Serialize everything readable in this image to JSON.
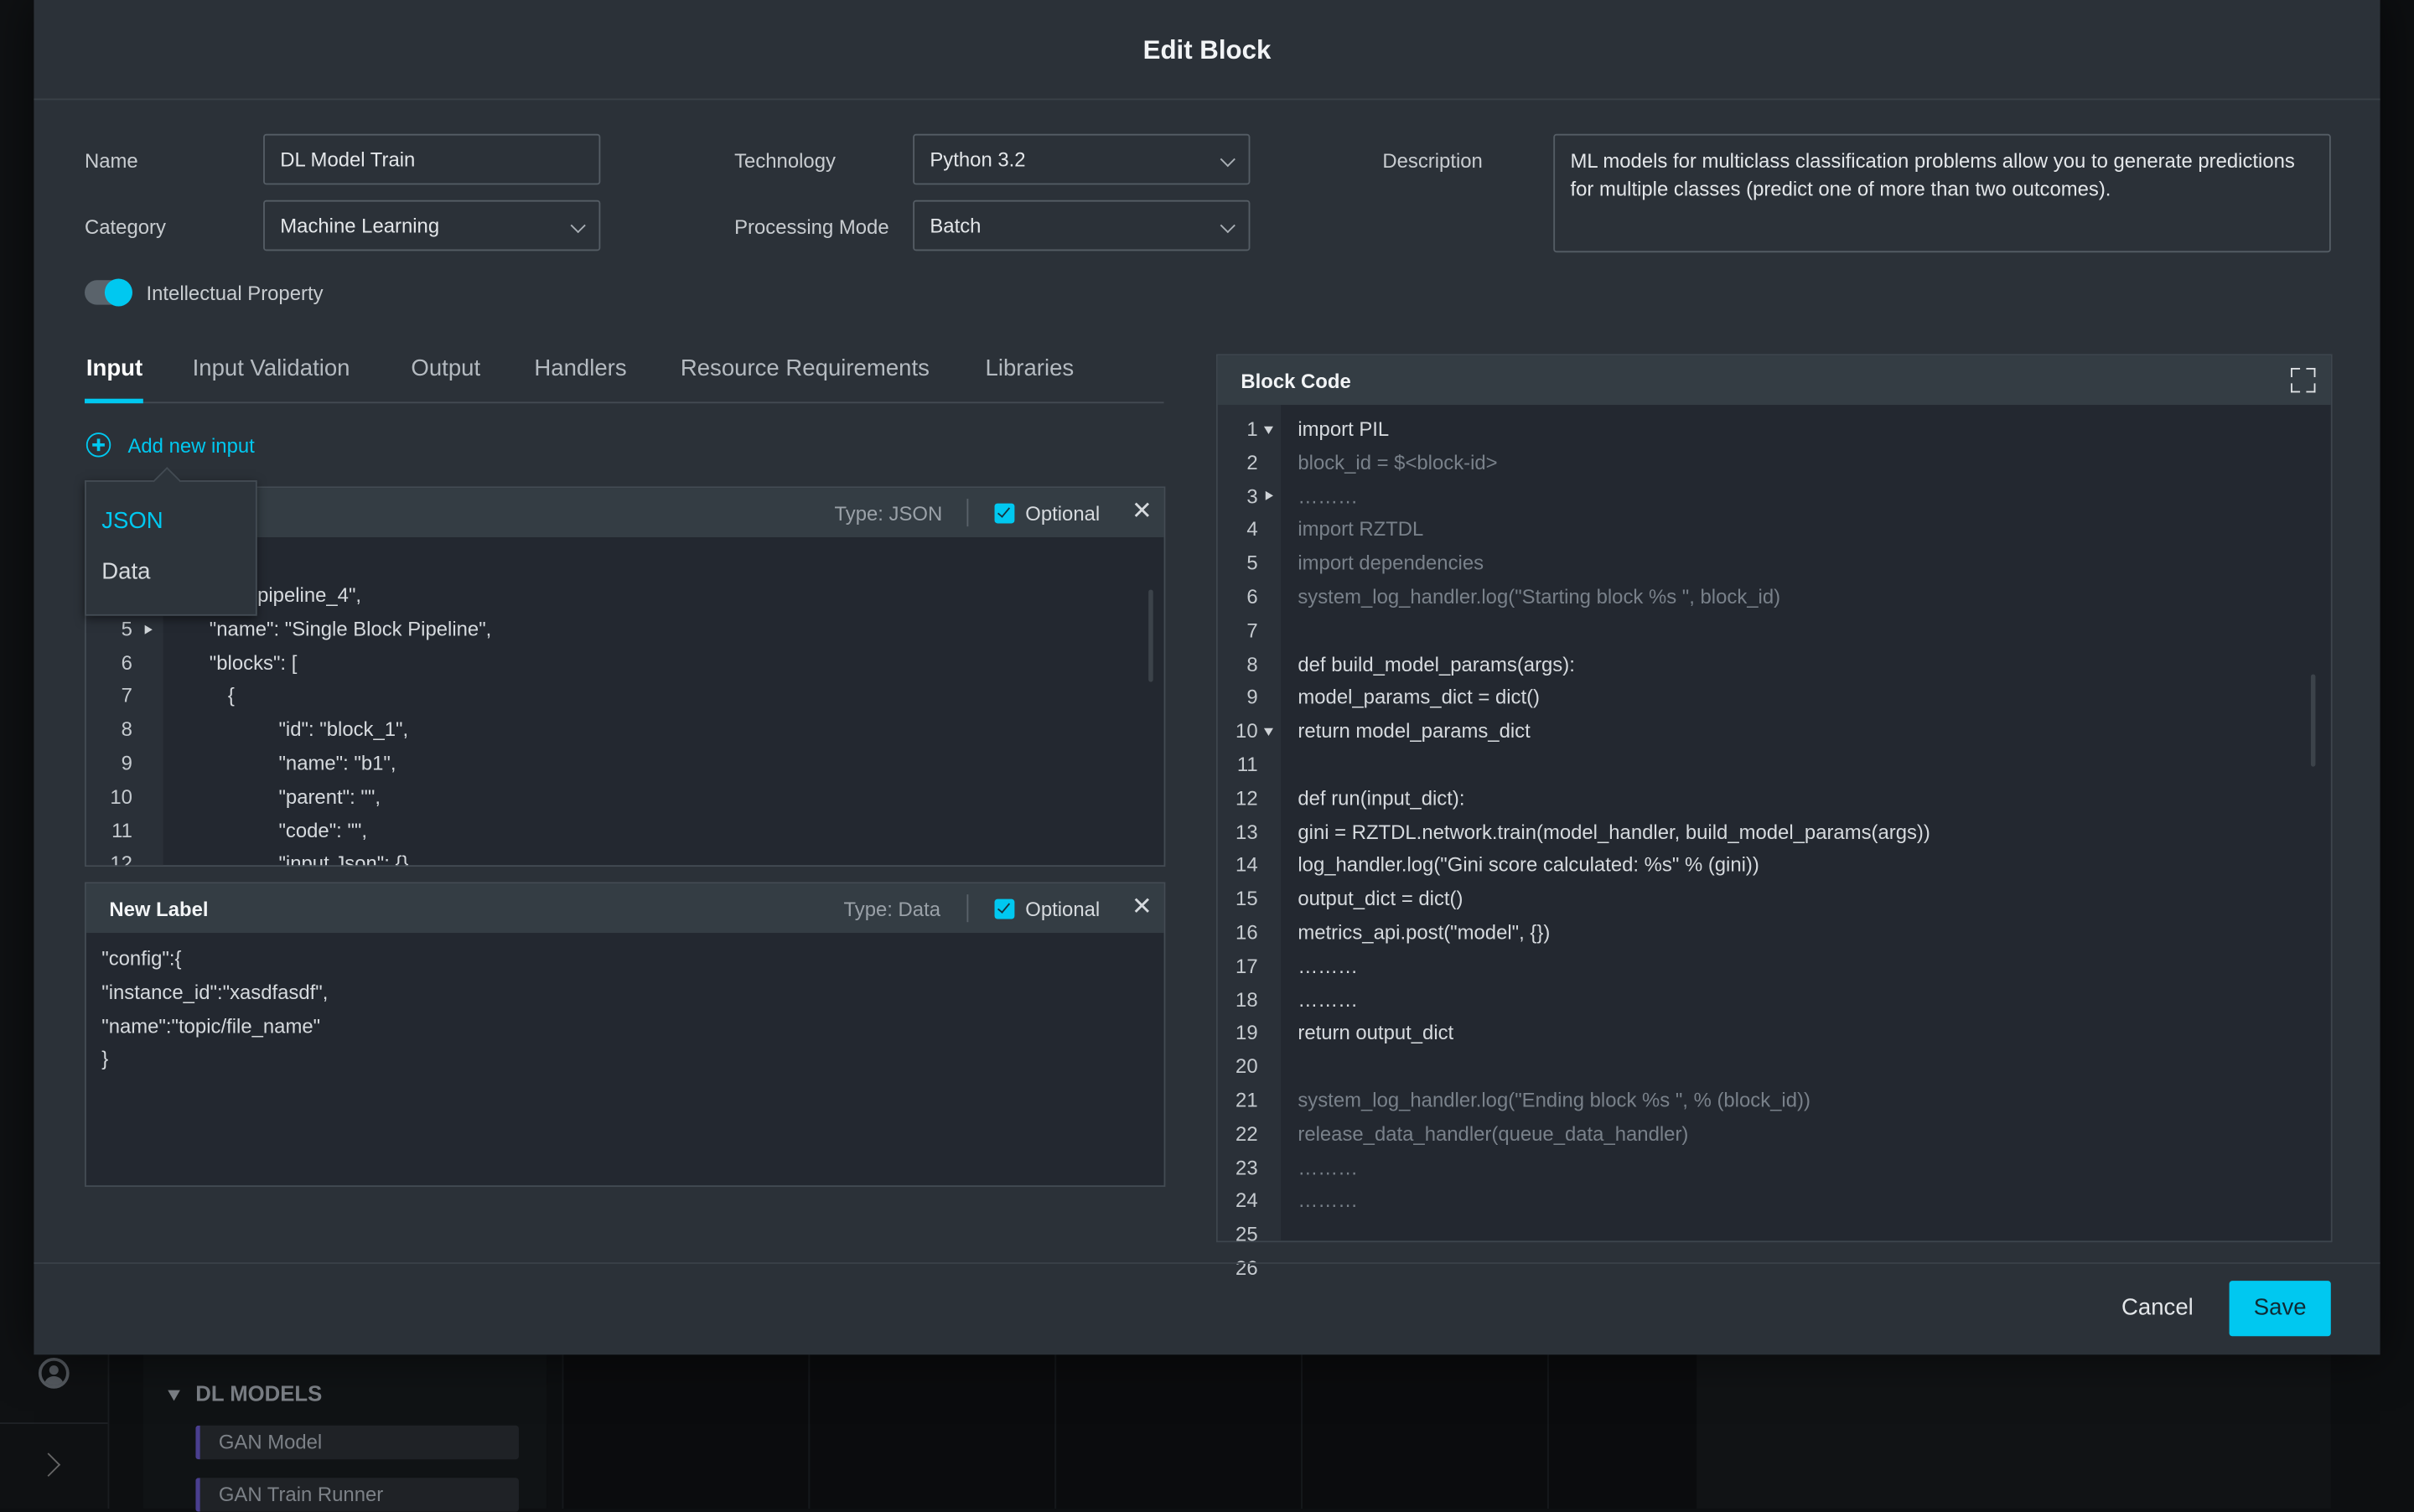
{
  "modal": {
    "title": "Edit Block"
  },
  "form": {
    "name_label": "Name",
    "name_value": "DL Model Train",
    "technology_label": "Technology",
    "technology_value": "Python 3.2",
    "description_label": "Description",
    "description_value": "ML models for multiclass classification problems allow you to generate predictions for multiple classes (predict one of more than two outcomes).",
    "category_label": "Category",
    "category_value": "Machine Learning",
    "processing_label": "Processing Mode",
    "processing_value": "Batch",
    "ip_label": "Intellectual Property",
    "ip_enabled": true
  },
  "tabs": [
    {
      "label": "Input",
      "active": true
    },
    {
      "label": "Input Validation"
    },
    {
      "label": "Output"
    },
    {
      "label": "Handlers"
    },
    {
      "label": "Resource Requirements"
    },
    {
      "label": "Libraries"
    }
  ],
  "add_input": {
    "label": "Add new input",
    "menu": [
      {
        "label": "JSON",
        "selected": true
      },
      {
        "label": "Data"
      }
    ]
  },
  "inputs": [
    {
      "label": "",
      "type": "Type: JSON",
      "optional_label": "Optional",
      "optional": true,
      "lines": [
        {
          "n": "4",
          "t": "\"id\": \"pipeline_4\","
        },
        {
          "n": "5",
          "t": "\"name\": \"Single Block Pipeline\",",
          "fold": "right"
        },
        {
          "n": "6",
          "t": "\"blocks\": ["
        },
        {
          "n": "7",
          "t": "{"
        },
        {
          "n": "8",
          "t": "\"id\": \"block_1\","
        },
        {
          "n": "9",
          "t": "\"name\": \"b1\","
        },
        {
          "n": "10",
          "t": "\"parent\": \"\","
        },
        {
          "n": "11",
          "t": "\"code\": \"\","
        },
        {
          "n": "12",
          "t": "\"input Json\": {}"
        }
      ]
    },
    {
      "label": "New Label",
      "type": "Type: Data",
      "optional_label": "Optional",
      "optional": true,
      "lines": [
        "\"config\":{",
        "\"instance_id\":\"xasdfasdf\",",
        "\"name\":\"topic/file_name\"",
        "}"
      ]
    }
  ],
  "block_code": {
    "title": "Block Code",
    "expand_icon": "expand-icon",
    "lines": [
      {
        "n": "1",
        "t": "import PIL",
        "s": "b",
        "fold": "down"
      },
      {
        "n": "2",
        "t": "block_id = $<block-id>",
        "s": "d"
      },
      {
        "n": "3",
        "t": "………",
        "s": "d",
        "fold": "right"
      },
      {
        "n": "4",
        "t": "import RZTDL",
        "s": "d"
      },
      {
        "n": "5",
        "t": "import dependencies",
        "s": "d"
      },
      {
        "n": "6",
        "t": "system_log_handler.log(\"Starting block %s \", block_id)",
        "s": "d"
      },
      {
        "n": "7",
        "t": "",
        "s": "b"
      },
      {
        "n": "8",
        "t": "def build_model_params(args):",
        "s": "b"
      },
      {
        "n": "9",
        "t": "model_params_dict = dict()",
        "s": "b"
      },
      {
        "n": "10",
        "t": "return model_params_dict",
        "s": "b",
        "fold": "down"
      },
      {
        "n": "11",
        "t": "",
        "s": "b"
      },
      {
        "n": "12",
        "t": "def run(input_dict):",
        "s": "b"
      },
      {
        "n": "13",
        "t": "gini = RZTDL.network.train(model_handler, build_model_params(args))",
        "s": "b"
      },
      {
        "n": "14",
        "t": "log_handler.log(\"Gini score calculated: %s\" % (gini))",
        "s": "b"
      },
      {
        "n": "15",
        "t": "output_dict = dict()",
        "s": "b"
      },
      {
        "n": "16",
        "t": "metrics_api.post(\"model\", {})",
        "s": "b"
      },
      {
        "n": "17",
        "t": "………",
        "s": "b"
      },
      {
        "n": "18",
        "t": "………",
        "s": "b"
      },
      {
        "n": "19",
        "t": "return output_dict",
        "s": "b"
      },
      {
        "n": "20",
        "t": "",
        "s": "b"
      },
      {
        "n": "21",
        "t": "system_log_handler.log(\"Ending block %s \", % (block_id))",
        "s": "d"
      },
      {
        "n": "22",
        "t": "release_data_handler(queue_data_handler)",
        "s": "d"
      },
      {
        "n": "23",
        "t": "………",
        "s": "d"
      },
      {
        "n": "24",
        "t": "………",
        "s": "d"
      },
      {
        "n": "25",
        "t": "",
        "s": "b"
      },
      {
        "n": "26",
        "t": "",
        "s": "b"
      }
    ]
  },
  "footer": {
    "cancel": "Cancel",
    "save": "Save"
  },
  "background": {
    "section": "DL MODELS",
    "items": [
      "GAN Model",
      "GAN Train Runner"
    ]
  },
  "colors": {
    "accent": "#00c8f0",
    "modal_bg": "#2b3138",
    "page_bg": "#0d0f11"
  }
}
